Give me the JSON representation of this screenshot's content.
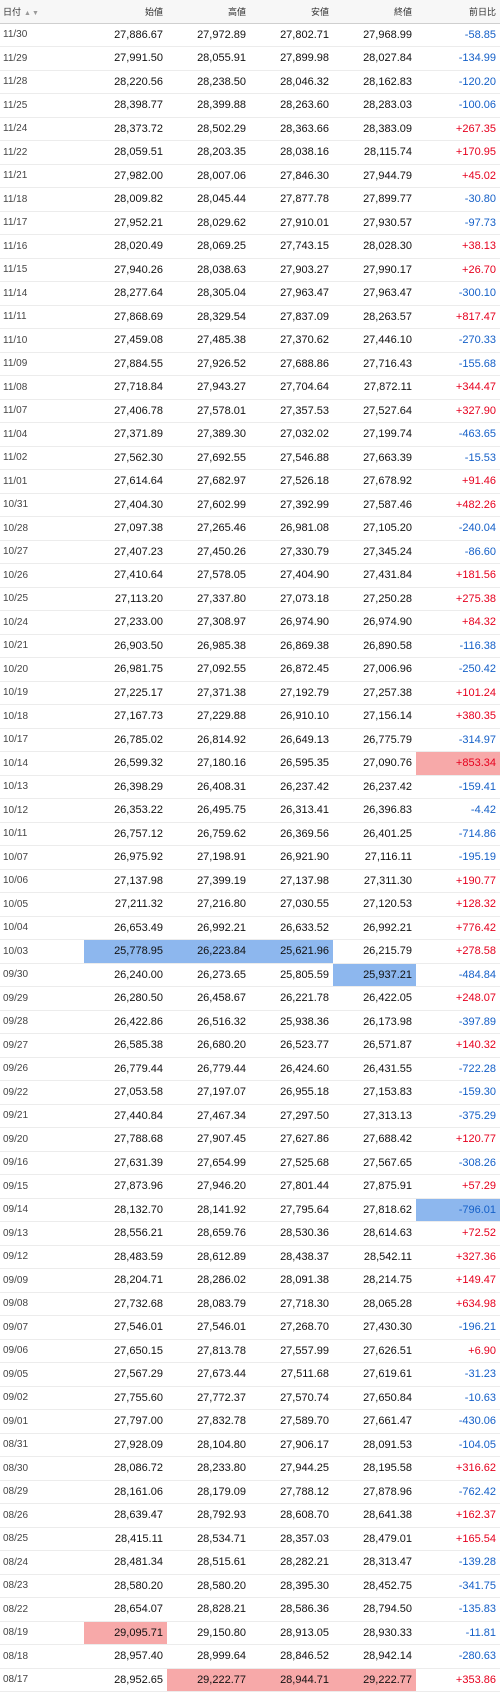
{
  "colors": {
    "up": "#e6001e",
    "down": "#1560c8",
    "highlight_high": "#f7a9a9",
    "highlight_low": "#8db7ee"
  },
  "table": {
    "headers": {
      "date": "日付",
      "open": "始値",
      "high": "高値",
      "low": "安値",
      "close": "終値",
      "change": "前日比"
    },
    "sort_icon": "sort-arrows-icon",
    "rows": [
      {
        "date": "11/30",
        "open": "27,886.67",
        "high": "27,972.89",
        "low": "27,802.71",
        "close": "27,968.99",
        "change": "-58.85",
        "dir": "down"
      },
      {
        "date": "11/29",
        "open": "27,991.50",
        "high": "28,055.91",
        "low": "27,899.98",
        "close": "28,027.84",
        "change": "-134.99",
        "dir": "down"
      },
      {
        "date": "11/28",
        "open": "28,220.56",
        "high": "28,238.50",
        "low": "28,046.32",
        "close": "28,162.83",
        "change": "-120.20",
        "dir": "down"
      },
      {
        "date": "11/25",
        "open": "28,398.77",
        "high": "28,399.88",
        "low": "28,263.60",
        "close": "28,283.03",
        "change": "-100.06",
        "dir": "down"
      },
      {
        "date": "11/24",
        "open": "28,373.72",
        "high": "28,502.29",
        "low": "28,363.66",
        "close": "28,383.09",
        "change": "+267.35",
        "dir": "up"
      },
      {
        "date": "11/22",
        "open": "28,059.51",
        "high": "28,203.35",
        "low": "28,038.16",
        "close": "28,115.74",
        "change": "+170.95",
        "dir": "up"
      },
      {
        "date": "11/21",
        "open": "27,982.00",
        "high": "28,007.06",
        "low": "27,846.30",
        "close": "27,944.79",
        "change": "+45.02",
        "dir": "up"
      },
      {
        "date": "11/18",
        "open": "28,009.82",
        "high": "28,045.44",
        "low": "27,877.78",
        "close": "27,899.77",
        "change": "-30.80",
        "dir": "down"
      },
      {
        "date": "11/17",
        "open": "27,952.21",
        "high": "28,029.62",
        "low": "27,910.01",
        "close": "27,930.57",
        "change": "-97.73",
        "dir": "down"
      },
      {
        "date": "11/16",
        "open": "28,020.49",
        "high": "28,069.25",
        "low": "27,743.15",
        "close": "28,028.30",
        "change": "+38.13",
        "dir": "up"
      },
      {
        "date": "11/15",
        "open": "27,940.26",
        "high": "28,038.63",
        "low": "27,903.27",
        "close": "27,990.17",
        "change": "+26.70",
        "dir": "up"
      },
      {
        "date": "11/14",
        "open": "28,277.64",
        "high": "28,305.04",
        "low": "27,963.47",
        "close": "27,963.47",
        "change": "-300.10",
        "dir": "down"
      },
      {
        "date": "11/11",
        "open": "27,868.69",
        "high": "28,329.54",
        "low": "27,837.09",
        "close": "28,263.57",
        "change": "+817.47",
        "dir": "up"
      },
      {
        "date": "11/10",
        "open": "27,459.08",
        "high": "27,485.38",
        "low": "27,370.62",
        "close": "27,446.10",
        "change": "-270.33",
        "dir": "down"
      },
      {
        "date": "11/09",
        "open": "27,884.55",
        "high": "27,926.52",
        "low": "27,688.86",
        "close": "27,716.43",
        "change": "-155.68",
        "dir": "down"
      },
      {
        "date": "11/08",
        "open": "27,718.84",
        "high": "27,943.27",
        "low": "27,704.64",
        "close": "27,872.11",
        "change": "+344.47",
        "dir": "up"
      },
      {
        "date": "11/07",
        "open": "27,406.78",
        "high": "27,578.01",
        "low": "27,357.53",
        "close": "27,527.64",
        "change": "+327.90",
        "dir": "up"
      },
      {
        "date": "11/04",
        "open": "27,371.89",
        "high": "27,389.30",
        "low": "27,032.02",
        "close": "27,199.74",
        "change": "-463.65",
        "dir": "down"
      },
      {
        "date": "11/02",
        "open": "27,562.30",
        "high": "27,692.55",
        "low": "27,546.88",
        "close": "27,663.39",
        "change": "-15.53",
        "dir": "down"
      },
      {
        "date": "11/01",
        "open": "27,614.64",
        "high": "27,682.97",
        "low": "27,526.18",
        "close": "27,678.92",
        "change": "+91.46",
        "dir": "up"
      },
      {
        "date": "10/31",
        "open": "27,404.30",
        "high": "27,602.99",
        "low": "27,392.99",
        "close": "27,587.46",
        "change": "+482.26",
        "dir": "up"
      },
      {
        "date": "10/28",
        "open": "27,097.38",
        "high": "27,265.46",
        "low": "26,981.08",
        "close": "27,105.20",
        "change": "-240.04",
        "dir": "down"
      },
      {
        "date": "10/27",
        "open": "27,407.23",
        "high": "27,450.26",
        "low": "27,330.79",
        "close": "27,345.24",
        "change": "-86.60",
        "dir": "down"
      },
      {
        "date": "10/26",
        "open": "27,410.64",
        "high": "27,578.05",
        "low": "27,404.90",
        "close": "27,431.84",
        "change": "+181.56",
        "dir": "up"
      },
      {
        "date": "10/25",
        "open": "27,113.20",
        "high": "27,337.80",
        "low": "27,073.18",
        "close": "27,250.28",
        "change": "+275.38",
        "dir": "up"
      },
      {
        "date": "10/24",
        "open": "27,233.00",
        "high": "27,308.97",
        "low": "26,974.90",
        "close": "26,974.90",
        "change": "+84.32",
        "dir": "up"
      },
      {
        "date": "10/21",
        "open": "26,903.50",
        "high": "26,985.38",
        "low": "26,869.38",
        "close": "26,890.58",
        "change": "-116.38",
        "dir": "down"
      },
      {
        "date": "10/20",
        "open": "26,981.75",
        "high": "27,092.55",
        "low": "26,872.45",
        "close": "27,006.96",
        "change": "-250.42",
        "dir": "down"
      },
      {
        "date": "10/19",
        "open": "27,225.17",
        "high": "27,371.38",
        "low": "27,192.79",
        "close": "27,257.38",
        "change": "+101.24",
        "dir": "up"
      },
      {
        "date": "10/18",
        "open": "27,167.73",
        "high": "27,229.88",
        "low": "26,910.10",
        "close": "27,156.14",
        "change": "+380.35",
        "dir": "up"
      },
      {
        "date": "10/17",
        "open": "26,785.02",
        "high": "26,814.92",
        "low": "26,649.13",
        "close": "26,775.79",
        "change": "-314.97",
        "dir": "down"
      },
      {
        "date": "10/14",
        "open": "26,599.32",
        "high": "27,180.16",
        "low": "26,595.35",
        "close": "27,090.76",
        "change": "+853.34",
        "dir": "up",
        "hl": {
          "change": "high"
        }
      },
      {
        "date": "10/13",
        "open": "26,398.29",
        "high": "26,408.31",
        "low": "26,237.42",
        "close": "26,237.42",
        "change": "-159.41",
        "dir": "down"
      },
      {
        "date": "10/12",
        "open": "26,353.22",
        "high": "26,495.75",
        "low": "26,313.41",
        "close": "26,396.83",
        "change": "-4.42",
        "dir": "down"
      },
      {
        "date": "10/11",
        "open": "26,757.12",
        "high": "26,759.62",
        "low": "26,369.56",
        "close": "26,401.25",
        "change": "-714.86",
        "dir": "down"
      },
      {
        "date": "10/07",
        "open": "26,975.92",
        "high": "27,198.91",
        "low": "26,921.90",
        "close": "27,116.11",
        "change": "-195.19",
        "dir": "down"
      },
      {
        "date": "10/06",
        "open": "27,137.98",
        "high": "27,399.19",
        "low": "27,137.98",
        "close": "27,311.30",
        "change": "+190.77",
        "dir": "up"
      },
      {
        "date": "10/05",
        "open": "27,211.32",
        "high": "27,216.80",
        "low": "27,030.55",
        "close": "27,120.53",
        "change": "+128.32",
        "dir": "up"
      },
      {
        "date": "10/04",
        "open": "26,653.49",
        "high": "26,992.21",
        "low": "26,633.52",
        "close": "26,992.21",
        "change": "+776.42",
        "dir": "up"
      },
      {
        "date": "10/03",
        "open": "25,778.95",
        "high": "26,223.84",
        "low": "25,621.96",
        "close": "26,215.79",
        "change": "+278.58",
        "dir": "up",
        "hl": {
          "open": "low",
          "high": "low",
          "low": "low"
        }
      },
      {
        "date": "09/30",
        "open": "26,240.00",
        "high": "26,273.65",
        "low": "25,805.59",
        "close": "25,937.21",
        "change": "-484.84",
        "dir": "down",
        "hl": {
          "close": "low"
        }
      },
      {
        "date": "09/29",
        "open": "26,280.50",
        "high": "26,458.67",
        "low": "26,221.78",
        "close": "26,422.05",
        "change": "+248.07",
        "dir": "up"
      },
      {
        "date": "09/28",
        "open": "26,422.86",
        "high": "26,516.32",
        "low": "25,938.36",
        "close": "26,173.98",
        "change": "-397.89",
        "dir": "down"
      },
      {
        "date": "09/27",
        "open": "26,585.38",
        "high": "26,680.20",
        "low": "26,523.77",
        "close": "26,571.87",
        "change": "+140.32",
        "dir": "up"
      },
      {
        "date": "09/26",
        "open": "26,779.44",
        "high": "26,779.44",
        "low": "26,424.60",
        "close": "26,431.55",
        "change": "-722.28",
        "dir": "down"
      },
      {
        "date": "09/22",
        "open": "27,053.58",
        "high": "27,197.07",
        "low": "26,955.18",
        "close": "27,153.83",
        "change": "-159.30",
        "dir": "down"
      },
      {
        "date": "09/21",
        "open": "27,440.84",
        "high": "27,467.34",
        "low": "27,297.50",
        "close": "27,313.13",
        "change": "-375.29",
        "dir": "down"
      },
      {
        "date": "09/20",
        "open": "27,788.68",
        "high": "27,907.45",
        "low": "27,627.86",
        "close": "27,688.42",
        "change": "+120.77",
        "dir": "up"
      },
      {
        "date": "09/16",
        "open": "27,631.39",
        "high": "27,654.99",
        "low": "27,525.68",
        "close": "27,567.65",
        "change": "-308.26",
        "dir": "down"
      },
      {
        "date": "09/15",
        "open": "27,873.96",
        "high": "27,946.20",
        "low": "27,801.44",
        "close": "27,875.91",
        "change": "+57.29",
        "dir": "up"
      },
      {
        "date": "09/14",
        "open": "28,132.70",
        "high": "28,141.92",
        "low": "27,795.64",
        "close": "27,818.62",
        "change": "-796.01",
        "dir": "down",
        "hl": {
          "change": "low"
        }
      },
      {
        "date": "09/13",
        "open": "28,556.21",
        "high": "28,659.76",
        "low": "28,530.36",
        "close": "28,614.63",
        "change": "+72.52",
        "dir": "up"
      },
      {
        "date": "09/12",
        "open": "28,483.59",
        "high": "28,612.89",
        "low": "28,438.37",
        "close": "28,542.11",
        "change": "+327.36",
        "dir": "up"
      },
      {
        "date": "09/09",
        "open": "28,204.71",
        "high": "28,286.02",
        "low": "28,091.38",
        "close": "28,214.75",
        "change": "+149.47",
        "dir": "up"
      },
      {
        "date": "09/08",
        "open": "27,732.68",
        "high": "28,083.79",
        "low": "27,718.30",
        "close": "28,065.28",
        "change": "+634.98",
        "dir": "up"
      },
      {
        "date": "09/07",
        "open": "27,546.01",
        "high": "27,546.01",
        "low": "27,268.70",
        "close": "27,430.30",
        "change": "-196.21",
        "dir": "down"
      },
      {
        "date": "09/06",
        "open": "27,650.15",
        "high": "27,813.78",
        "low": "27,557.99",
        "close": "27,626.51",
        "change": "+6.90",
        "dir": "up"
      },
      {
        "date": "09/05",
        "open": "27,567.29",
        "high": "27,673.44",
        "low": "27,511.68",
        "close": "27,619.61",
        "change": "-31.23",
        "dir": "down"
      },
      {
        "date": "09/02",
        "open": "27,755.60",
        "high": "27,772.37",
        "low": "27,570.74",
        "close": "27,650.84",
        "change": "-10.63",
        "dir": "down"
      },
      {
        "date": "09/01",
        "open": "27,797.00",
        "high": "27,832.78",
        "low": "27,589.70",
        "close": "27,661.47",
        "change": "-430.06",
        "dir": "down"
      },
      {
        "date": "08/31",
        "open": "27,928.09",
        "high": "28,104.80",
        "low": "27,906.17",
        "close": "28,091.53",
        "change": "-104.05",
        "dir": "down"
      },
      {
        "date": "08/30",
        "open": "28,086.72",
        "high": "28,233.80",
        "low": "27,944.25",
        "close": "28,195.58",
        "change": "+316.62",
        "dir": "up"
      },
      {
        "date": "08/29",
        "open": "28,161.06",
        "high": "28,179.09",
        "low": "27,788.12",
        "close": "27,878.96",
        "change": "-762.42",
        "dir": "down"
      },
      {
        "date": "08/26",
        "open": "28,639.47",
        "high": "28,792.93",
        "low": "28,608.70",
        "close": "28,641.38",
        "change": "+162.37",
        "dir": "up"
      },
      {
        "date": "08/25",
        "open": "28,415.11",
        "high": "28,534.71",
        "low": "28,357.03",
        "close": "28,479.01",
        "change": "+165.54",
        "dir": "up"
      },
      {
        "date": "08/24",
        "open": "28,481.34",
        "high": "28,515.61",
        "low": "28,282.21",
        "close": "28,313.47",
        "change": "-139.28",
        "dir": "down"
      },
      {
        "date": "08/23",
        "open": "28,580.20",
        "high": "28,580.20",
        "low": "28,395.30",
        "close": "28,452.75",
        "change": "-341.75",
        "dir": "down"
      },
      {
        "date": "08/22",
        "open": "28,654.07",
        "high": "28,828.21",
        "low": "28,586.36",
        "close": "28,794.50",
        "change": "-135.83",
        "dir": "down"
      },
      {
        "date": "08/19",
        "open": "29,095.71",
        "high": "29,150.80",
        "low": "28,913.05",
        "close": "28,930.33",
        "change": "-11.81",
        "dir": "down",
        "hl": {
          "open": "high"
        }
      },
      {
        "date": "08/18",
        "open": "28,957.40",
        "high": "28,999.64",
        "low": "28,846.52",
        "close": "28,942.14",
        "change": "-280.63",
        "dir": "down"
      },
      {
        "date": "08/17",
        "open": "28,952.65",
        "high": "29,222.77",
        "low": "28,944.71",
        "close": "29,222.77",
        "change": "+353.86",
        "dir": "up",
        "hl": {
          "high": "high",
          "low": "high",
          "close": "high"
        }
      }
    ]
  }
}
